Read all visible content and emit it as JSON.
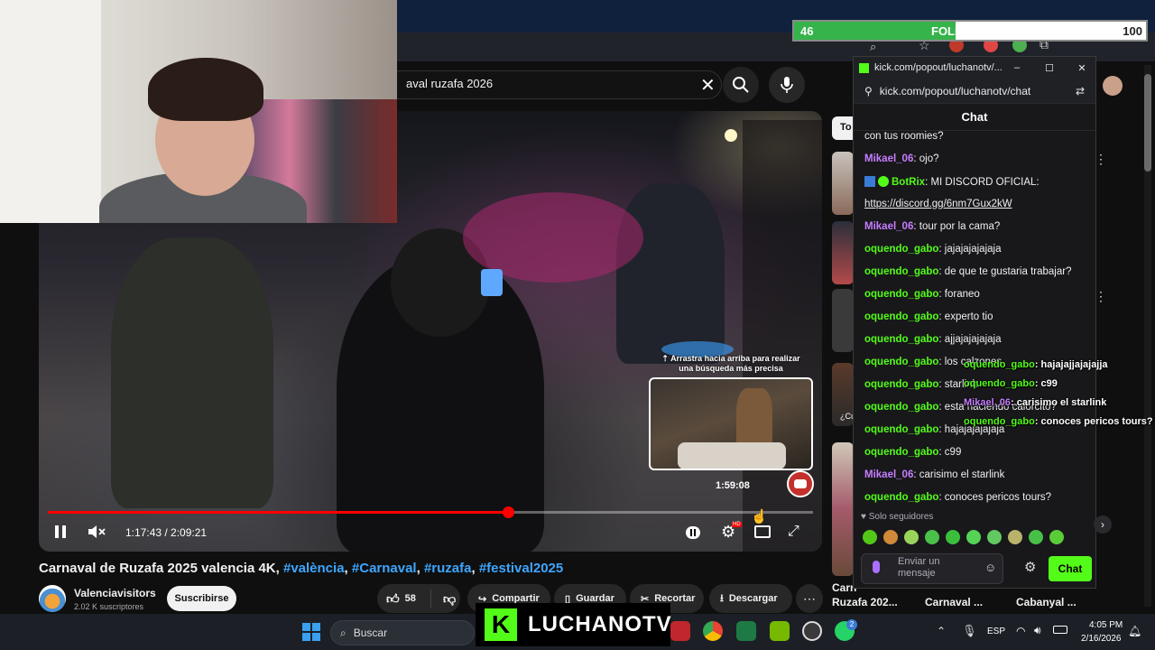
{
  "browser": {
    "search_query": "aval ruzafa 2026"
  },
  "followers_bar": {
    "current": "46",
    "label": "FOLLOWERS",
    "goal": "100",
    "fraction": 0.46
  },
  "video": {
    "search_up_hint": "Arrastra hacia arriba para realizar una búsqueda más precisa",
    "preview_time": "1:59:08",
    "time_display": "1:17:43 / 2:09:21",
    "progress_fraction": 0.601
  },
  "info": {
    "title_text": "Carnaval de Ruzafa 2025 valencia 4K,",
    "hashtags": [
      "#valència",
      "#Carnaval",
      "#ruzafa",
      "#festival2025"
    ],
    "channel_name": "Valenciavisitors",
    "subscribers": "2.02 K suscriptores",
    "subscribe_label": "Suscribirse",
    "likes": "58",
    "share_label": "Compartir",
    "save_label": "Guardar",
    "clip_label": "Recortar",
    "download_label": "Descargar"
  },
  "recommendations": {
    "filter_chip": "To",
    "titles": [
      "Carn",
      "Ruzafa 202...",
      "Carnaval ...",
      "Cabanyal ..."
    ],
    "snippet": "¿Cu"
  },
  "chat": {
    "window_title": "kick.com/popout/luchanotv/...",
    "url": "kick.com/popout/luchanotv/chat",
    "header": "Chat",
    "messages": [
      {
        "user": "",
        "text": "con tus roomies?",
        "color": "#efeff1"
      },
      {
        "user": "Mikael_06",
        "text": ": ojo?",
        "color": "#c77dff"
      },
      {
        "user": "BotRix",
        "text": ": MI DISCORD OFICIAL:",
        "color": "#53fc18"
      },
      {
        "user": "",
        "text": "https://discord.gg/6nm7Gux2kW",
        "color": "#efeff1"
      },
      {
        "user": "Mikael_06",
        "text": ": tour por la cama?",
        "color": "#c77dff"
      },
      {
        "user": "oquendo_gabo",
        "text": ": jajajajajajaja",
        "color": "#53fc18"
      },
      {
        "user": "oquendo_gabo",
        "text": ": de que te gustaria trabajar?",
        "color": "#53fc18"
      },
      {
        "user": "oquendo_gabo",
        "text": ": foraneo",
        "color": "#53fc18"
      },
      {
        "user": "oquendo_gabo",
        "text": ": experto tio",
        "color": "#53fc18"
      },
      {
        "user": "oquendo_gabo",
        "text": ": ajjajajajajaja",
        "color": "#53fc18"
      },
      {
        "user": "oquendo_gabo",
        "text": ": los calzones",
        "color": "#53fc18"
      },
      {
        "user": "oquendo_gabo",
        "text": ": starlink",
        "color": "#53fc18"
      },
      {
        "user": "oquendo_gabo",
        "text": ": esta haciendo calorcito?",
        "color": "#53fc18"
      },
      {
        "user": "oquendo_gabo",
        "text": ": hajajajajajaja",
        "color": "#53fc18"
      },
      {
        "user": "oquendo_gabo",
        "text": ": c99",
        "color": "#53fc18"
      },
      {
        "user": "Mikael_06",
        "text": ": carisimo el starlink",
        "color": "#c77dff"
      },
      {
        "user": "oquendo_gabo",
        "text": ": conoces pericos tours?",
        "color": "#53fc18"
      }
    ],
    "followers_only": "Solo seguidores",
    "input_placeholder": "Enviar un mensaje",
    "send_label": "Chat"
  },
  "overlay_chat": [
    {
      "user": "oquendo_gabo",
      "text": ": hajajajjajajajja",
      "color": "#53fc18"
    },
    {
      "user": "oquendo_gabo",
      "text": ": c99",
      "color": "#53fc18"
    },
    {
      "user": "Mikael_06",
      "text": ": carisimo el starlink",
      "color": "#c77dff"
    },
    {
      "user": "oquendo_gabo",
      "text": ": conoces pericos tours?",
      "color": "#53fc18"
    }
  ],
  "taskbar": {
    "search_placeholder": "Buscar",
    "stream_brand": "LUCHANOTV",
    "language": "ESP",
    "time": "4:05 PM",
    "date": "2/16/2026",
    "whatsapp_badge": "2"
  }
}
